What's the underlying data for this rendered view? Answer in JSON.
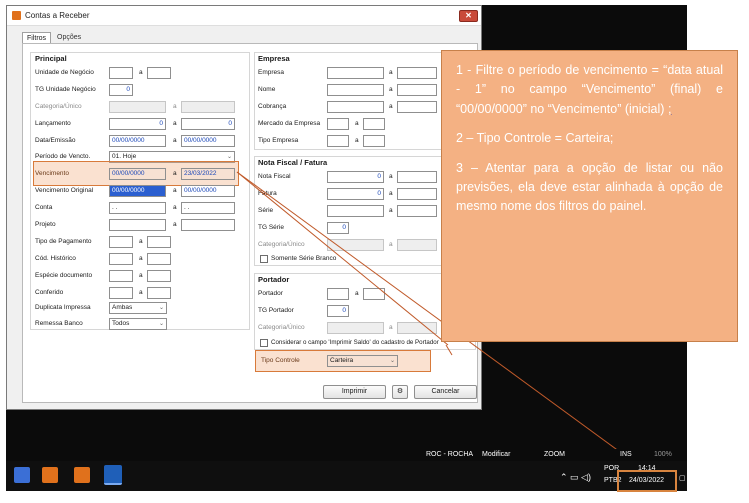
{
  "window": {
    "title": "Contas a Receber",
    "close": "✕"
  },
  "tabs": [
    "Filtros",
    "Opções"
  ],
  "principal": {
    "title": "Principal",
    "unidade_negocio": {
      "label": "Unidade de Negócio",
      "sep": "a",
      "from": "",
      "to": ""
    },
    "tg_unidade": {
      "label": "TG Unidade Negócio",
      "value": "0"
    },
    "categoria": {
      "label": "Categoria/Único",
      "sep": "a"
    },
    "lancamento": {
      "label": "Lançamento",
      "from": "0",
      "sep": "a",
      "to": "0"
    },
    "data_emissao": {
      "label": "Data/Emissão",
      "from": "00/00/0000",
      "sep": "a",
      "to": "00/00/0000"
    },
    "periodo_vencto": {
      "label": "Período de Vencto.",
      "value": "01. Hoje"
    },
    "vencimento": {
      "label": "Vencimento",
      "from": "00/00/0000",
      "sep": "a",
      "to": "23/03/2022"
    },
    "vencimento_original": {
      "label": "Vencimento Original",
      "from": "00/00/0000",
      "sep": "a",
      "to": "00/00/0000"
    },
    "conta": {
      "label": "Conta",
      "from": ". .",
      "sep": "a",
      "to": ". ."
    },
    "projeto": {
      "label": "Projeto",
      "sep": "a"
    },
    "tipo_pagamento": {
      "label": "Tipo de Pagamento",
      "sep": "a"
    },
    "cod_historico": {
      "label": "Cód. Histórico",
      "sep": "a"
    },
    "especie_documento": {
      "label": "Espécie documento",
      "sep": "a"
    },
    "conferido": {
      "label": "Conferido",
      "sep": "a"
    },
    "duplicata_impressa": {
      "label": "Duplicata Impressa",
      "value": "Ambas"
    },
    "remessa_banco": {
      "label": "Remessa Banco",
      "value": "Todos"
    }
  },
  "empresa": {
    "title": "Empresa",
    "empresa": {
      "label": "Empresa",
      "sep": "a"
    },
    "nome": {
      "label": "Nome",
      "sep": "a"
    },
    "cobranca": {
      "label": "Cobrança",
      "sep": "a"
    },
    "mercado": {
      "label": "Mercado da Empresa",
      "sep": "a"
    },
    "tipo_empresa": {
      "label": "Tipo Empresa",
      "sep": "a"
    }
  },
  "nota_fiscal": {
    "title": "Nota Fiscal / Fatura",
    "nota_fiscal": {
      "label": "Nota Fiscal",
      "from": "0",
      "sep": "a"
    },
    "fatura": {
      "label": "Fatura",
      "from": "0",
      "sep": "a"
    },
    "serie": {
      "label": "Série",
      "sep": "a"
    },
    "tg_serie": {
      "label": "TG Série",
      "value": "0"
    },
    "categoria": {
      "label": "Categoria/Único",
      "sep": "a"
    },
    "somente_serie_branco": "Somente Série Branco"
  },
  "portador": {
    "title": "Portador",
    "portador": {
      "label": "Portador",
      "sep": "a"
    },
    "tg_portador": {
      "label": "TG Portador",
      "value": "0"
    },
    "categoria": {
      "label": "Categoria/Único",
      "sep": "a"
    },
    "imprimir_saldo": "Considerar o campo 'Imprimir Saldo' do cadastro de Portador"
  },
  "tipo_controle": {
    "label": "Tipo Controle",
    "value": "Carteira"
  },
  "buttons": {
    "imprimir": "Imprimir",
    "cancelar": "Cancelar"
  },
  "note": {
    "p1_a": "1 - Filtre o período de vencimento = “data atual - 1” no campo “Vencimento” (final) e “00/00/0000” no “Vencimento” (inicial)",
    "p1_link": ";",
    "p2": "2 – Tipo Controle = Carteira;",
    "p3": "3 – Atentar para a opção de listar ou não previsões, ela deve estar alinhada à opção de mesmo nome dos filtros do painel."
  },
  "statusbar": {
    "user": "ROC - ROCHA",
    "mode": "Modificar",
    "zoom_label": "ZOOM",
    "ins": "INS",
    "zoom_value": "100%"
  },
  "tray": {
    "lang1": "POR",
    "lang2": "PTB2",
    "time": "14:14",
    "date": "24/03/2022"
  },
  "colors": {
    "highlight": "#f4b183",
    "highlight_border": "#d87a3a"
  }
}
